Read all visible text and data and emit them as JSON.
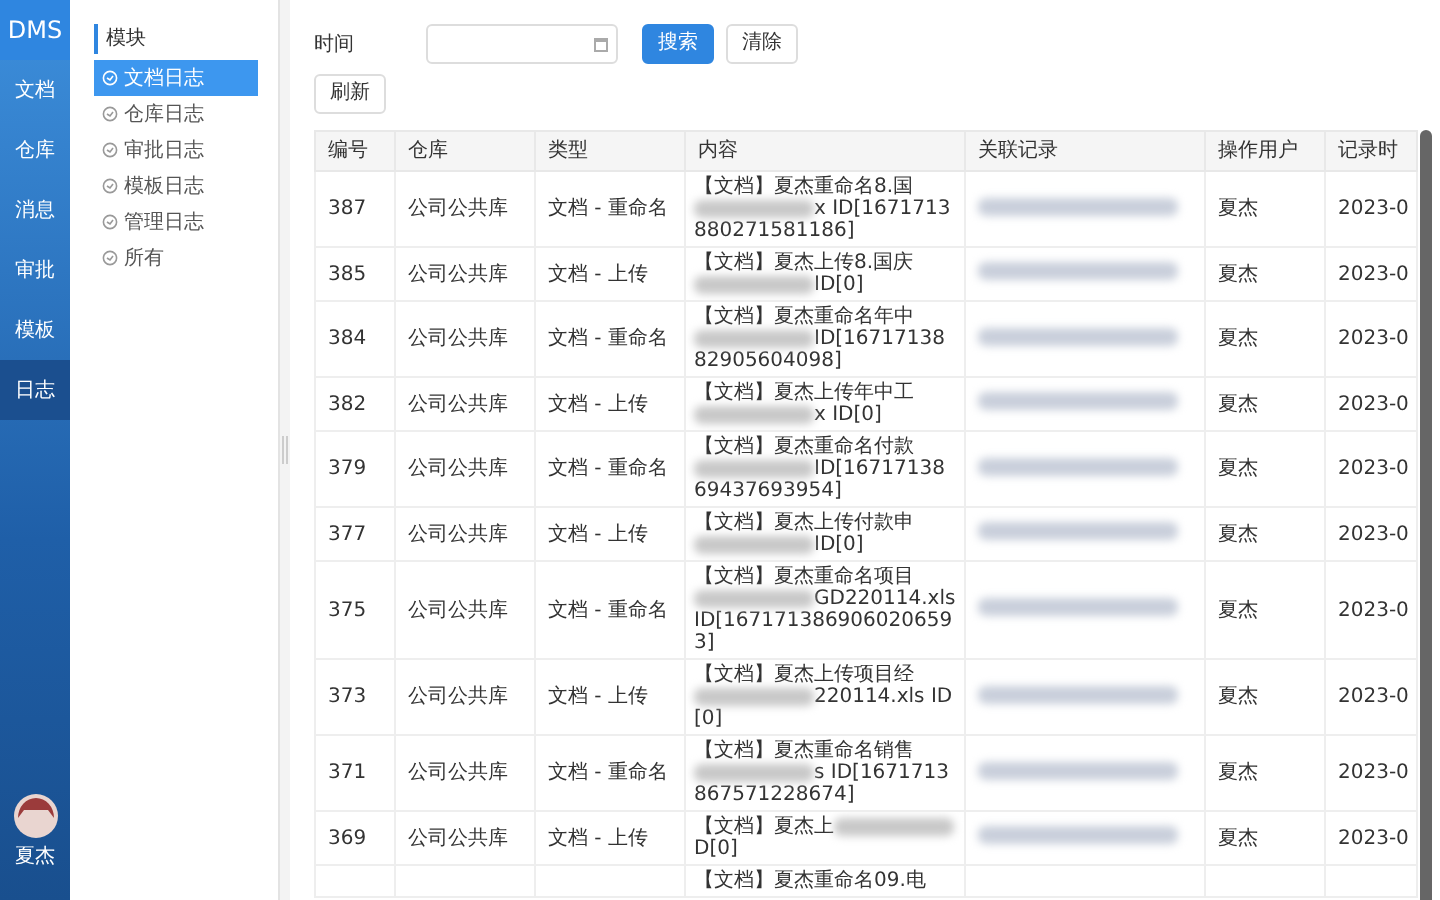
{
  "app": {
    "logo": "DMS",
    "user": "夏杰"
  },
  "nav": [
    {
      "label": "文档",
      "selected": false
    },
    {
      "label": "仓库",
      "selected": false
    },
    {
      "label": "消息",
      "selected": false
    },
    {
      "label": "审批",
      "selected": false
    },
    {
      "label": "模板",
      "selected": false
    },
    {
      "label": "日志",
      "selected": true
    }
  ],
  "modules": {
    "title": "模块",
    "items": [
      {
        "label": "文档日志",
        "selected": true
      },
      {
        "label": "仓库日志",
        "selected": false
      },
      {
        "label": "审批日志",
        "selected": false
      },
      {
        "label": "模板日志",
        "selected": false
      },
      {
        "label": "管理日志",
        "selected": false
      },
      {
        "label": "所有",
        "selected": false
      }
    ]
  },
  "filter": {
    "label": "时间",
    "search": "搜索",
    "clear": "清除",
    "refresh": "刷新"
  },
  "table": {
    "columns": [
      "编号",
      "仓库",
      "类型",
      "内容",
      "关联记录",
      "操作用户",
      "记录时"
    ],
    "rows": [
      {
        "id": "387",
        "repo": "公司公共库",
        "type": "文档 - 重命名",
        "lead": "【文档】夏杰重命名8.国",
        "tail": "x ID[1671713880271581186]",
        "user": "夏杰",
        "time": "2023-0"
      },
      {
        "id": "385",
        "repo": "公司公共库",
        "type": "文档 - 上传",
        "lead": "【文档】夏杰上传8.国庆",
        "tail": "ID[0]",
        "user": "夏杰",
        "time": "2023-0"
      },
      {
        "id": "384",
        "repo": "公司公共库",
        "type": "文档 - 重命名",
        "lead": "【文档】夏杰重命名年中",
        "tail": "ID[1671713882905604098]",
        "user": "夏杰",
        "time": "2023-0"
      },
      {
        "id": "382",
        "repo": "公司公共库",
        "type": "文档 - 上传",
        "lead": "【文档】夏杰上传年中工",
        "tail": "x ID[0]",
        "user": "夏杰",
        "time": "2023-0"
      },
      {
        "id": "379",
        "repo": "公司公共库",
        "type": "文档 - 重命名",
        "lead": "【文档】夏杰重命名付款",
        "tail": "ID[1671713869437693954]",
        "user": "夏杰",
        "time": "2023-0"
      },
      {
        "id": "377",
        "repo": "公司公共库",
        "type": "文档 - 上传",
        "lead": "【文档】夏杰上传付款申",
        "tail": "ID[0]",
        "user": "夏杰",
        "time": "2023-0"
      },
      {
        "id": "375",
        "repo": "公司公共库",
        "type": "文档 - 重命名",
        "lead": "【文档】夏杰重命名项目",
        "tail": "GD220114.xls ID[1671713869060206593]",
        "user": "夏杰",
        "time": "2023-0"
      },
      {
        "id": "373",
        "repo": "公司公共库",
        "type": "文档 - 上传",
        "lead": "【文档】夏杰上传项目经",
        "tail": "220114.xls ID[0]",
        "user": "夏杰",
        "time": "2023-0"
      },
      {
        "id": "371",
        "repo": "公司公共库",
        "type": "文档 - 重命名",
        "lead": "【文档】夏杰重命名销售",
        "tail": "s ID[1671713867571228674]",
        "user": "夏杰",
        "time": "2023-0"
      },
      {
        "id": "369",
        "repo": "公司公共库",
        "type": "文档 - 上传",
        "lead": "【文档】夏杰上",
        "tail": "D[0]",
        "user": "夏杰",
        "time": "2023-0"
      },
      {
        "lead": "【文档】夏杰重命名09.电"
      }
    ]
  }
}
